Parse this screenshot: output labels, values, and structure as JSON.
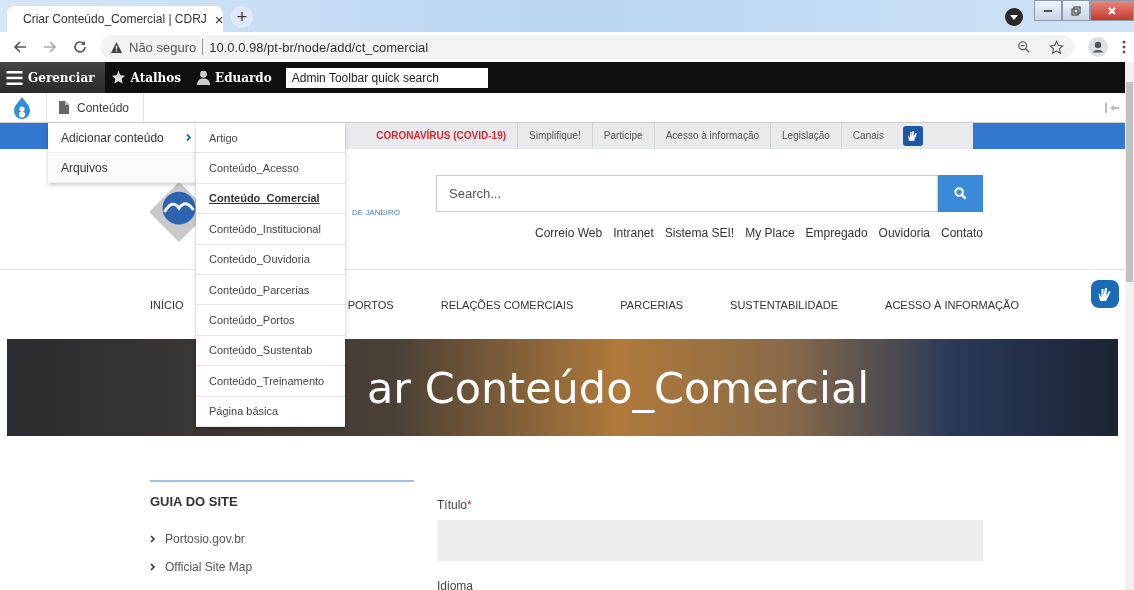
{
  "browser": {
    "tab": {
      "title": "Criar Conteúdo_Comercial | CDRJ",
      "close": "×"
    },
    "new_tab": "+",
    "address": {
      "security": "Não seguro",
      "url": "10.0.0.98/pt-br/node/add/ct_comercial"
    }
  },
  "admin_toolbar": {
    "items": [
      {
        "label": "Gerenciar",
        "selected": true
      },
      {
        "label": "Atalhos",
        "selected": false
      },
      {
        "label": "Eduardo",
        "selected": false
      }
    ],
    "search": {
      "placeholder": "Admin Toolbar quick search"
    }
  },
  "secondary_toolbar": {
    "items": [
      {
        "label": "Conteúdo"
      }
    ]
  },
  "menu": {
    "items": [
      {
        "label": "Adicionar conteúdo",
        "expanded": true
      },
      {
        "label": "Arquivos",
        "expanded": false
      }
    ],
    "submenu": [
      {
        "label": "Artigo",
        "selected": false
      },
      {
        "label": "Conteúdo_Acesso",
        "selected": false
      },
      {
        "label": "Conteúdo_Comercial",
        "selected": true
      },
      {
        "label": "Conteúdo_Institucional",
        "selected": false
      },
      {
        "label": "Conteúdo_Ouvidoria",
        "selected": false
      },
      {
        "label": "Conteúdo_Parcerias",
        "selected": false
      },
      {
        "label": "Conteúdo_Portos",
        "selected": false
      },
      {
        "label": "Conteúdo_Sustentab",
        "selected": false
      },
      {
        "label": "Conteúdo_Treinamento",
        "selected": false
      },
      {
        "label": "Página básica",
        "selected": false
      }
    ]
  },
  "gov_bar": {
    "links": [
      {
        "label": "CORONAVÍRUS (COVID-19)",
        "color": "#d9282f"
      },
      {
        "label": "Simplifique!",
        "color": "#555555"
      },
      {
        "label": "Participe",
        "color": "#555555"
      },
      {
        "label": "Acesso à informação",
        "color": "#555555"
      },
      {
        "label": "Legislação",
        "color": "#555555"
      },
      {
        "label": "Canais",
        "color": "#555555"
      }
    ]
  },
  "header": {
    "logo_text": "DE JANEIRO",
    "search": {
      "placeholder": "Search..."
    },
    "links": [
      "Correio Web",
      "Intranet",
      "Sistema SEI!",
      "My Place",
      "Empregado",
      "Ouvidoria",
      "Contato"
    ]
  },
  "nav": [
    "INÍCIO",
    "PORTOS",
    "RELAÇÕES COMERCIAIS",
    "PARCERIAS",
    "SUSTENTABILIDADE",
    "ACESSO À INFORMAÇÃO"
  ],
  "hero": {
    "title": "ar Conteúdo_Comercial"
  },
  "sidebar": {
    "title": "GUIA DO SITE",
    "links": [
      "Portosio.gov.br",
      "Official Site Map"
    ]
  },
  "form": {
    "fields": [
      {
        "label": "Título",
        "required_mark": "*"
      },
      {
        "label": "Idioma"
      }
    ]
  }
}
